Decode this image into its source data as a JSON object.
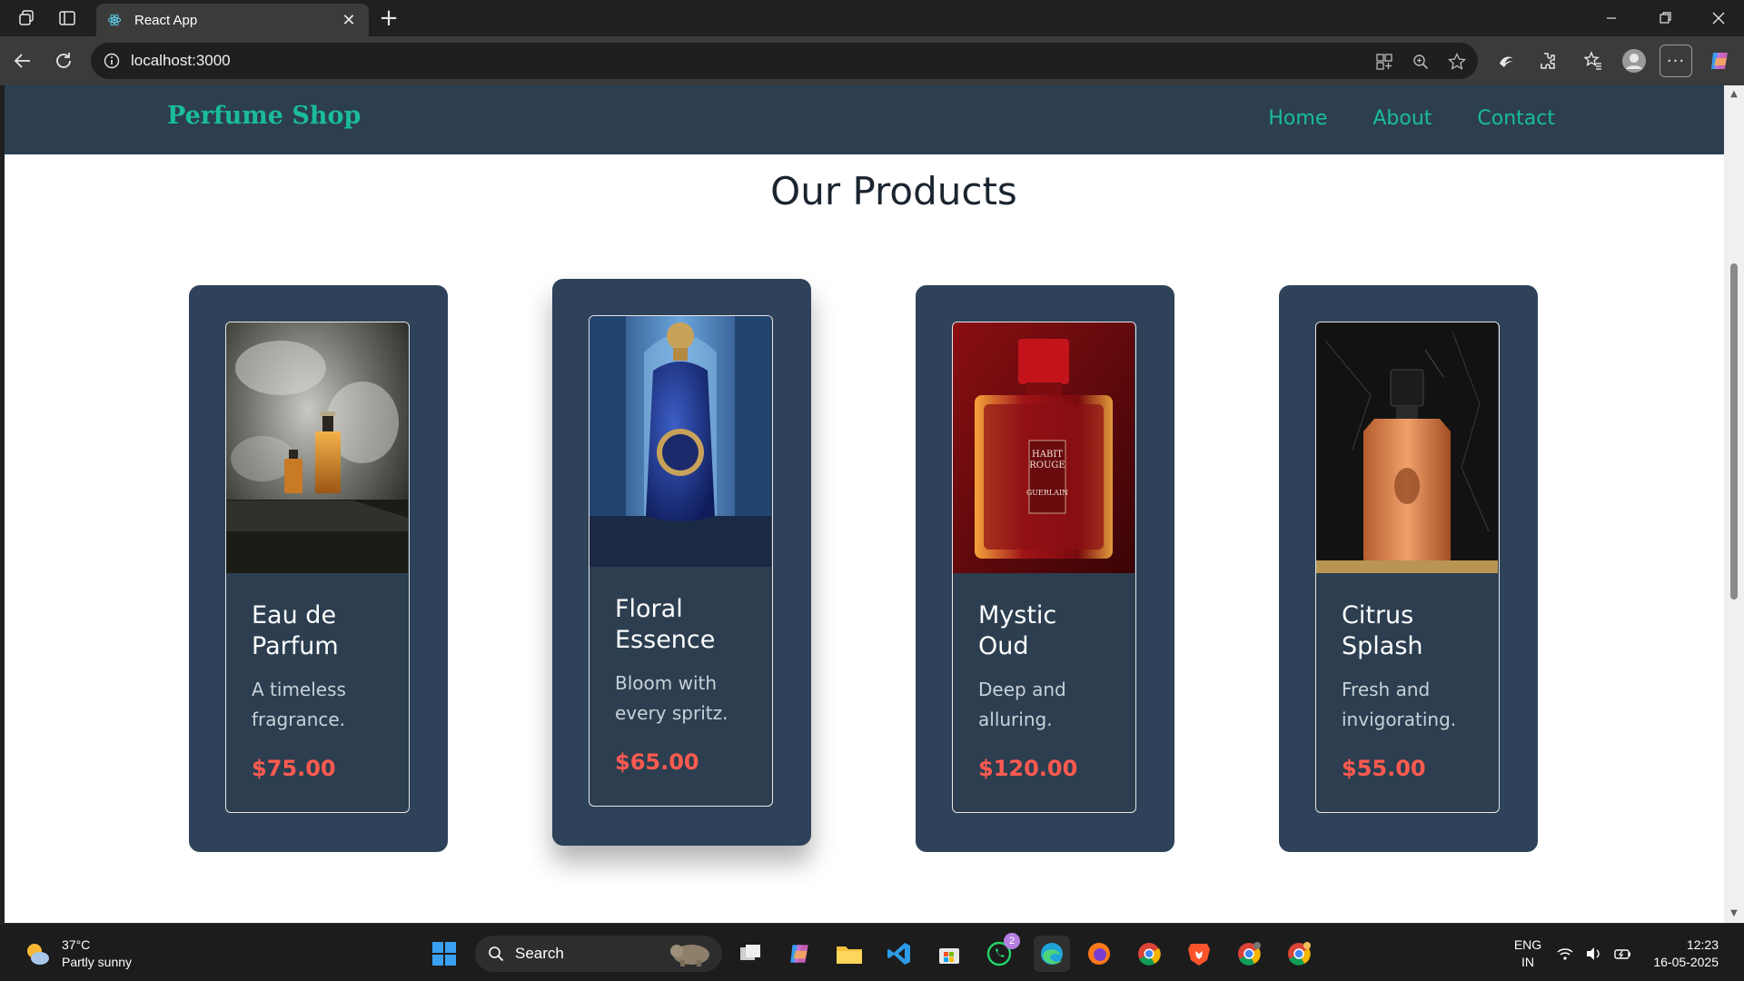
{
  "browser": {
    "tab_title": "React App",
    "url": "localhost:3000"
  },
  "site": {
    "brand": "Perfume Shop",
    "nav": [
      "Home",
      "About",
      "Contact"
    ],
    "heading": "Our Products"
  },
  "products": [
    {
      "name": "Eau de Parfum",
      "description": "A timeless fragrance.",
      "price": "$75.00"
    },
    {
      "name": "Floral Essence",
      "description": "Bloom with every spritz.",
      "price": "$65.00"
    },
    {
      "name": "Mystic Oud",
      "description": "Deep and alluring.",
      "price": "$120.00"
    },
    {
      "name": "Citrus Splash",
      "description": "Fresh and invigorating.",
      "price": "$55.00"
    }
  ],
  "bottle_labels": {
    "mystic_oud": [
      "HABIT",
      "ROUGE",
      "GUERLAIN"
    ]
  },
  "taskbar": {
    "weather_temp": "37°C",
    "weather_desc": "Partly sunny",
    "search_label": "Search",
    "whatsapp_badge": "2",
    "lang_top": "ENG",
    "lang_bottom": "IN",
    "time": "12:23",
    "date": "16-05-2025"
  },
  "colors": {
    "nav_bg": "#2c3e50",
    "accent": "#1abc9c",
    "price": "#ff5a4f",
    "card_bg": "#2e4259"
  }
}
